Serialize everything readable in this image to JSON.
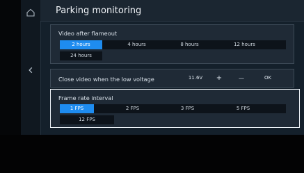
{
  "header": {
    "title": "Parking monitoring"
  },
  "video_after_flameout": {
    "title": "Video after flameout",
    "options": [
      "2 hours",
      "4 hours",
      "8 hours",
      "12 hours",
      "24 hours"
    ],
    "selected": "2 hours"
  },
  "close_video_low_voltage": {
    "title": "Close video when the low voltage",
    "value": "11.6V",
    "plus_label": "+",
    "minus_label": "—",
    "ok_label": "OK"
  },
  "frame_rate_interval": {
    "title": "Frame rate interval",
    "options": [
      "1 FPS",
      "2 FPS",
      "3 FPS",
      "5 FPS",
      "12 FPS"
    ],
    "selected": "1 FPS"
  },
  "icons": {
    "home": "home-icon",
    "back": "chevron-left-icon"
  },
  "colors": {
    "accent": "#1e8cf0",
    "background": "#14202b",
    "card": "#1f2a36",
    "focus_border": "#eef3f8"
  }
}
